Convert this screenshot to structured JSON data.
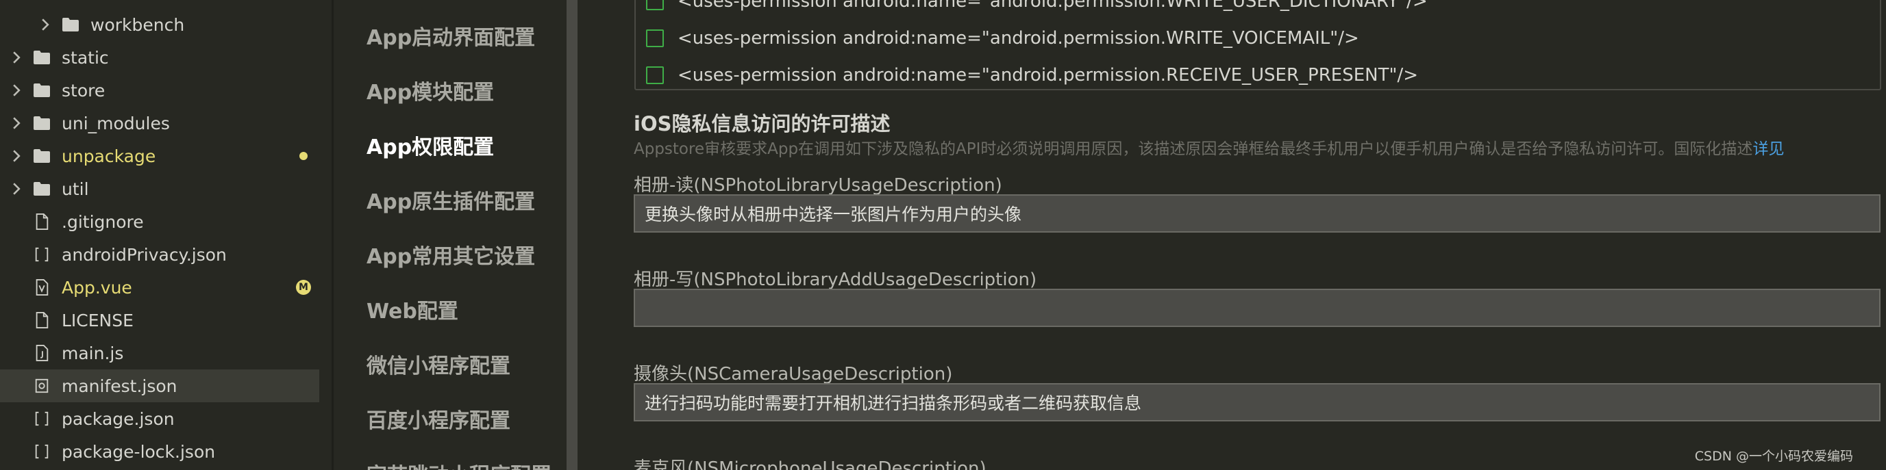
{
  "file_tree": {
    "items": [
      {
        "name": "workbench",
        "type": "folder",
        "expandable": true,
        "indent": 1,
        "modified": false
      },
      {
        "name": "static",
        "type": "folder",
        "expandable": true,
        "indent": 0,
        "modified": false
      },
      {
        "name": "store",
        "type": "folder",
        "expandable": true,
        "indent": 0,
        "modified": false
      },
      {
        "name": "uni_modules",
        "type": "folder",
        "expandable": true,
        "indent": 0,
        "modified": false
      },
      {
        "name": "unpackage",
        "type": "folder",
        "expandable": true,
        "indent": 0,
        "modified": true
      },
      {
        "name": "util",
        "type": "folder",
        "expandable": true,
        "indent": 0,
        "modified": false
      },
      {
        "name": ".gitignore",
        "type": "file-plain",
        "indent": 0,
        "modified": false
      },
      {
        "name": "androidPrivacy.json",
        "type": "file-json",
        "indent": 0,
        "modified": false
      },
      {
        "name": "App.vue",
        "type": "file-vue",
        "indent": 0,
        "modified": true,
        "badge": "M"
      },
      {
        "name": "LICENSE",
        "type": "file-plain",
        "indent": 0,
        "modified": false
      },
      {
        "name": "main.js",
        "type": "file-js",
        "indent": 0,
        "modified": false
      },
      {
        "name": "manifest.json",
        "type": "file-manifest",
        "indent": 0,
        "modified": false,
        "selected": true
      },
      {
        "name": "package.json",
        "type": "file-json",
        "indent": 0,
        "modified": false
      },
      {
        "name": "package-lock.json",
        "type": "file-json",
        "indent": 0,
        "modified": false
      }
    ]
  },
  "settings_nav": {
    "items": [
      {
        "label": "App启动界面配置",
        "active": false
      },
      {
        "label": "App模块配置",
        "active": false
      },
      {
        "label": "App权限配置",
        "active": true
      },
      {
        "label": "App原生插件配置",
        "active": false
      },
      {
        "label": "App常用其它设置",
        "active": false
      },
      {
        "label": "Web配置",
        "active": false
      },
      {
        "label": "微信小程序配置",
        "active": false
      },
      {
        "label": "百度小程序配置",
        "active": false
      },
      {
        "label": "字节跳动小程序配置",
        "active": false
      }
    ]
  },
  "permissions": {
    "items": [
      {
        "text": "<uses-permission android:name=\"android.permission.WRITE_USER_DICTIONARY\"/>",
        "checked": false
      },
      {
        "text": "<uses-permission android:name=\"android.permission.WRITE_VOICEMAIL\"/>",
        "checked": false
      },
      {
        "text": "<uses-permission android:name=\"android.permission.RECEIVE_USER_PRESENT\"/>",
        "checked": false
      }
    ]
  },
  "ios_privacy": {
    "title": "iOS隐私信息访问的许可描述",
    "description": "Appstore审核要求App在调用如下涉及隐私的API时必须说明调用原因，该描述原因会弹框给最终手机用户以便手机用户确认是否给予隐私访问许可。国际化描述",
    "details_link": "详见",
    "fields": [
      {
        "label": "相册-读(NSPhotoLibraryUsageDescription)",
        "value": "更换头像时从相册中选择一张图片作为用户的头像"
      },
      {
        "label": "相册-写(NSPhotoLibraryAddUsageDescription)",
        "value": ""
      },
      {
        "label": "摄像头(NSCameraUsageDescription)",
        "value": "进行扫码功能时需要打开相机进行扫描条形码或者二维码获取信息"
      },
      {
        "label": "麦克风(NSMicrophoneUsageDescription)",
        "value": ""
      }
    ]
  },
  "watermark": "CSDN @一个小码农爱编码",
  "colors": {
    "background": "#272822",
    "modified": "#e6db74",
    "checkbox": "#3fae47",
    "link": "#4b9fe0"
  }
}
